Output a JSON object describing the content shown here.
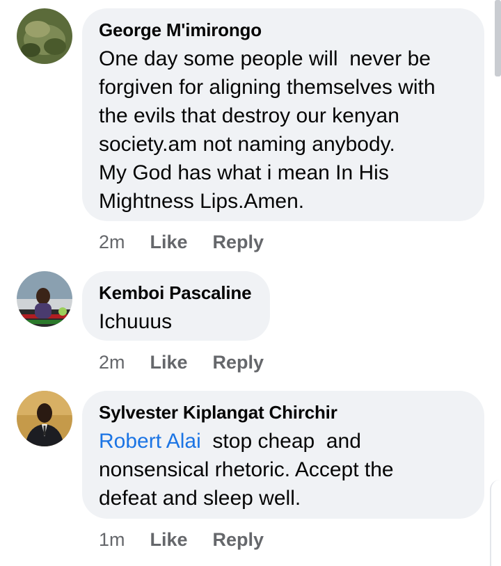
{
  "comments": [
    {
      "author": "George M'imirongo",
      "text": "One day some people will  never be\nforgiven for aligning themselves with\nthe evils that destroy our kenyan\nsociety.am not naming anybody.\nMy God has what i mean In His\nMightness Lips.Amen.",
      "time": "2m",
      "like": "Like",
      "reply": "Reply"
    },
    {
      "author": "Kemboi Pascaline",
      "text": "Ichuuus",
      "time": "2m",
      "like": "Like",
      "reply": "Reply"
    },
    {
      "author": "Sylvester Kiplangat Chirchir",
      "mention": "Robert Alai",
      "text": "  stop cheap  and\nnonsensical rhetoric. Accept the\ndefeat and sleep well.",
      "time": "1m",
      "like": "Like",
      "reply": "Reply"
    }
  ],
  "colors": {
    "bubble": "#f0f2f5",
    "mention": "#1b74e4",
    "meta": "#65676b"
  }
}
